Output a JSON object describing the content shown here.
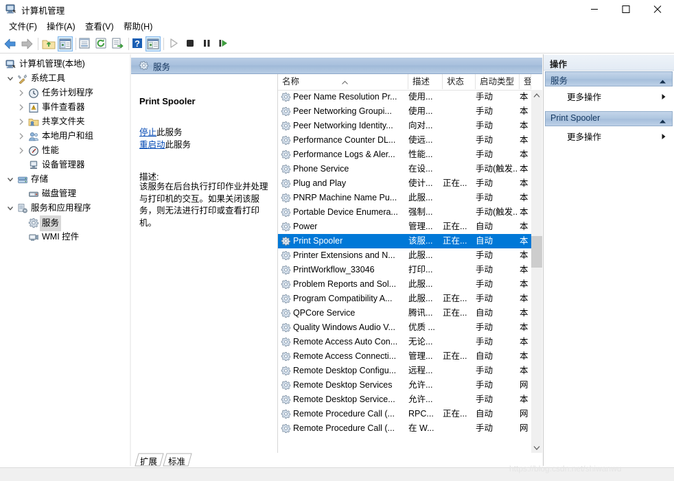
{
  "window": {
    "title": "计算机管理",
    "icon": "computer-management-icon",
    "minimize_label": "最小化",
    "maximize_label": "最大化",
    "close_label": "关闭"
  },
  "menubar": {
    "items": [
      {
        "label": "文件(F)",
        "name": "menu-file"
      },
      {
        "label": "操作(A)",
        "name": "menu-action"
      },
      {
        "label": "查看(V)",
        "name": "menu-view"
      },
      {
        "label": "帮助(H)",
        "name": "menu-help"
      }
    ]
  },
  "toolbar": {
    "buttons": [
      {
        "name": "back-icon",
        "tooltip": "后退"
      },
      {
        "name": "forward-icon",
        "tooltip": "前进"
      },
      {
        "name": "up-folder-icon",
        "tooltip": "向上一级"
      },
      {
        "name": "show-tree-pane-icon",
        "tooltip": "显示/隐藏控制台树",
        "active": true
      },
      {
        "name": "properties-icon",
        "tooltip": "属性"
      },
      {
        "name": "refresh-icon",
        "tooltip": "刷新"
      },
      {
        "name": "export-list-icon",
        "tooltip": "导出列表"
      },
      {
        "name": "help-icon",
        "tooltip": "帮助"
      },
      {
        "name": "show-action-pane-icon",
        "tooltip": "显示/隐藏操作窗格",
        "active": true
      },
      {
        "name": "start-service-icon",
        "tooltip": "启动服务",
        "disabled": true
      },
      {
        "name": "stop-service-icon",
        "tooltip": "停止服务"
      },
      {
        "name": "pause-service-icon",
        "tooltip": "暂停服务"
      },
      {
        "name": "restart-service-icon",
        "tooltip": "重启动服务"
      }
    ]
  },
  "tree": {
    "nodes": [
      {
        "label": "计算机管理(本地)",
        "depth": 0,
        "chevron": "none",
        "icon": "computer-icon",
        "selected": false
      },
      {
        "label": "系统工具",
        "depth": 1,
        "chevron": "expanded",
        "icon": "tools-icon",
        "selected": false
      },
      {
        "label": "任务计划程序",
        "depth": 2,
        "chevron": "collapsed",
        "icon": "clock-icon",
        "selected": false
      },
      {
        "label": "事件查看器",
        "depth": 2,
        "chevron": "collapsed",
        "icon": "event-viewer-icon",
        "selected": false
      },
      {
        "label": "共享文件夹",
        "depth": 2,
        "chevron": "collapsed",
        "icon": "shared-folder-icon",
        "selected": false
      },
      {
        "label": "本地用户和组",
        "depth": 2,
        "chevron": "collapsed",
        "icon": "users-icon",
        "selected": false
      },
      {
        "label": "性能",
        "depth": 2,
        "chevron": "collapsed",
        "icon": "performance-icon",
        "selected": false
      },
      {
        "label": "设备管理器",
        "depth": 2,
        "chevron": "none",
        "icon": "device-manager-icon",
        "selected": false
      },
      {
        "label": "存储",
        "depth": 1,
        "chevron": "expanded",
        "icon": "storage-icon",
        "selected": false
      },
      {
        "label": "磁盘管理",
        "depth": 2,
        "chevron": "none",
        "icon": "disk-icon",
        "selected": false
      },
      {
        "label": "服务和应用程序",
        "depth": 1,
        "chevron": "expanded",
        "icon": "services-apps-icon",
        "selected": false
      },
      {
        "label": "服务",
        "depth": 2,
        "chevron": "none",
        "icon": "service-gear-icon",
        "selected": true
      },
      {
        "label": "WMI 控件",
        "depth": 2,
        "chevron": "none",
        "icon": "wmi-icon",
        "selected": false
      }
    ]
  },
  "middle": {
    "header_title": "服务",
    "header_icon": "service-gear-icon"
  },
  "detail": {
    "service_name": "Print Spooler",
    "links": [
      {
        "link_text": "停止",
        "rest_text": "此服务",
        "name": "stop-service-link"
      },
      {
        "link_text": "重启动",
        "rest_text": "此服务",
        "name": "restart-service-link"
      }
    ],
    "description_label": "描述:",
    "description": "该服务在后台执行打印作业并处理与打印机的交互。如果关闭该服务，则无法进行打印或查看打印机。"
  },
  "list": {
    "columns": [
      {
        "label": "名称",
        "name": "column-name",
        "sort": "asc"
      },
      {
        "label": "描述",
        "name": "column-description",
        "sort": "none"
      },
      {
        "label": "状态",
        "name": "column-status",
        "sort": "none"
      },
      {
        "label": "启动类型",
        "name": "column-startup-type",
        "sort": "none"
      },
      {
        "label": "登",
        "name": "column-logon-as",
        "sort": "none"
      }
    ],
    "rows": [
      {
        "name": "Peer Name Resolution Pr...",
        "description": "使用...",
        "status": "",
        "startup": "手动",
        "logon": "本"
      },
      {
        "name": "Peer Networking Groupi...",
        "description": "使用...",
        "status": "",
        "startup": "手动",
        "logon": "本"
      },
      {
        "name": "Peer Networking Identity...",
        "description": "向对...",
        "status": "",
        "startup": "手动",
        "logon": "本"
      },
      {
        "name": "Performance Counter DL...",
        "description": "使远...",
        "status": "",
        "startup": "手动",
        "logon": "本"
      },
      {
        "name": "Performance Logs & Aler...",
        "description": "性能...",
        "status": "",
        "startup": "手动",
        "logon": "本"
      },
      {
        "name": "Phone Service",
        "description": "在设...",
        "status": "",
        "startup": "手动(触发...",
        "logon": "本"
      },
      {
        "name": "Plug and Play",
        "description": "使计...",
        "status": "正在...",
        "startup": "手动",
        "logon": "本"
      },
      {
        "name": "PNRP Machine Name Pu...",
        "description": "此服...",
        "status": "",
        "startup": "手动",
        "logon": "本"
      },
      {
        "name": "Portable Device Enumera...",
        "description": "强制...",
        "status": "",
        "startup": "手动(触发...",
        "logon": "本"
      },
      {
        "name": "Power",
        "description": "管理...",
        "status": "正在...",
        "startup": "自动",
        "logon": "本"
      },
      {
        "name": "Print Spooler",
        "description": "该服...",
        "status": "正在...",
        "startup": "自动",
        "logon": "本",
        "selected": true
      },
      {
        "name": "Printer Extensions and N...",
        "description": "此服...",
        "status": "",
        "startup": "手动",
        "logon": "本"
      },
      {
        "name": "PrintWorkflow_33046",
        "description": "打印...",
        "status": "",
        "startup": "手动",
        "logon": "本"
      },
      {
        "name": "Problem Reports and Sol...",
        "description": "此服...",
        "status": "",
        "startup": "手动",
        "logon": "本"
      },
      {
        "name": "Program Compatibility A...",
        "description": "此服...",
        "status": "正在...",
        "startup": "手动",
        "logon": "本"
      },
      {
        "name": "QPCore Service",
        "description": "腾讯...",
        "status": "正在...",
        "startup": "自动",
        "logon": "本"
      },
      {
        "name": "Quality Windows Audio V...",
        "description": "优质 ...",
        "status": "",
        "startup": "手动",
        "logon": "本"
      },
      {
        "name": "Remote Access Auto Con...",
        "description": "无论...",
        "status": "",
        "startup": "手动",
        "logon": "本"
      },
      {
        "name": "Remote Access Connecti...",
        "description": "管理...",
        "status": "正在...",
        "startup": "自动",
        "logon": "本"
      },
      {
        "name": "Remote Desktop Configu...",
        "description": "远程...",
        "status": "",
        "startup": "手动",
        "logon": "本"
      },
      {
        "name": "Remote Desktop Services",
        "description": "允许...",
        "status": "",
        "startup": "手动",
        "logon": "网"
      },
      {
        "name": "Remote Desktop Service...",
        "description": "允许...",
        "status": "",
        "startup": "手动",
        "logon": "本"
      },
      {
        "name": "Remote Procedure Call (...",
        "description": "RPC...",
        "status": "正在...",
        "startup": "自动",
        "logon": "网"
      },
      {
        "name": "Remote Procedure Call (...",
        "description": "在 W...",
        "status": "",
        "startup": "手动",
        "logon": "网"
      }
    ]
  },
  "actions": {
    "header": "操作",
    "groups": [
      {
        "title": "服务",
        "name": "action-group-services",
        "items": [
          {
            "label": "更多操作",
            "name": "more-actions-services"
          }
        ]
      },
      {
        "title": "Print Spooler",
        "name": "action-group-print-spooler",
        "items": [
          {
            "label": "更多操作",
            "name": "more-actions-print-spooler"
          }
        ]
      }
    ]
  },
  "tabs": [
    {
      "label": "扩展",
      "name": "tab-extended",
      "active": true
    },
    {
      "label": "标准",
      "name": "tab-standard",
      "active": false
    }
  ],
  "watermark": "https://blog.csdn.net/shiwanwu",
  "colors": {
    "selection_blue": "#0078d7",
    "header_blue": "#a8c0dd",
    "link_blue": "#0047b3"
  }
}
